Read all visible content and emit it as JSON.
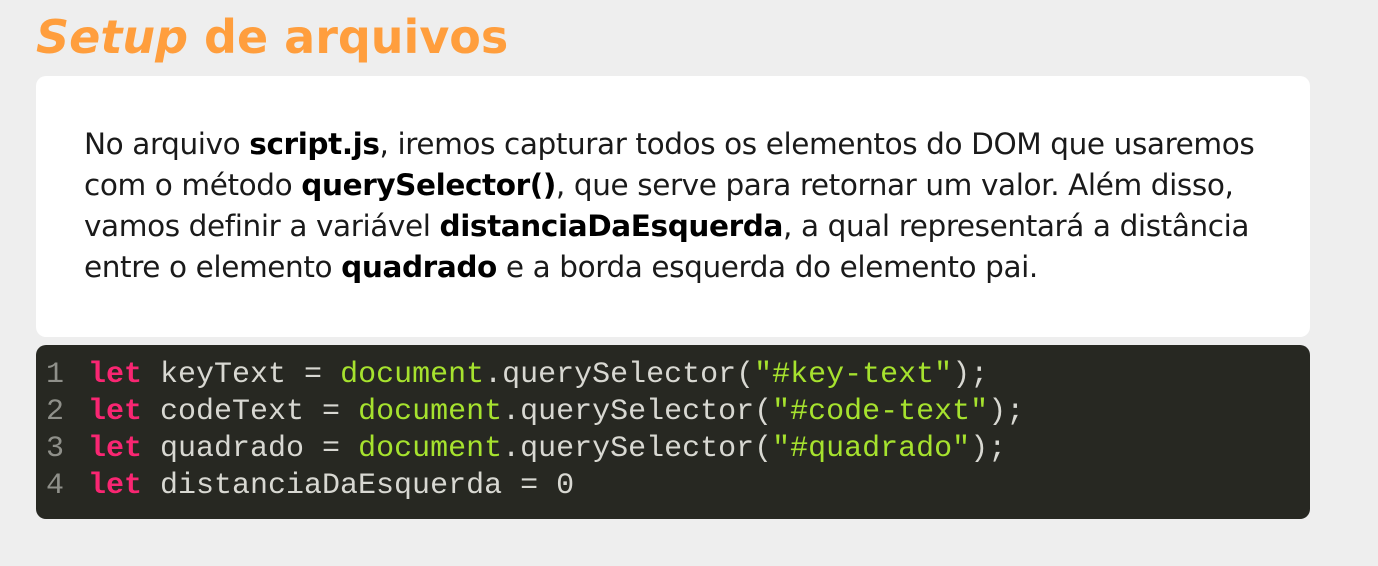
{
  "title": {
    "italic": "Setup",
    "rest": " de arquivos"
  },
  "paragraph": {
    "p1": "No arquivo ",
    "b1": "script.js",
    "p2": ", iremos capturar todos os elementos do DOM que usaremos com o método ",
    "b2": "querySelector()",
    "p3": ", que serve para retornar um valor. Além disso, vamos definir a variável ",
    "b3": "distanciaDaEsquerda",
    "p4": ", a qual representará a distância entre o elemento ",
    "b4": "quadrado",
    "p5": " e a borda esquerda do elemento pai."
  },
  "code": {
    "lines": [
      {
        "num": "1",
        "kw": "let",
        "name": " keyText = ",
        "obj": "document",
        "method": ".querySelector(",
        "str": "\"#key-text\"",
        "end": ");"
      },
      {
        "num": "2",
        "kw": "let",
        "name": " codeText = ",
        "obj": "document",
        "method": ".querySelector(",
        "str": "\"#code-text\"",
        "end": ");"
      },
      {
        "num": "3",
        "kw": "let",
        "name": " quadrado = ",
        "obj": "document",
        "method": ".querySelector(",
        "str": "\"#quadrado\"",
        "end": ");"
      },
      {
        "num": "4",
        "kw": "let",
        "name": " distanciaDaEsquerda = 0",
        "obj": "",
        "method": "",
        "str": "",
        "end": ""
      }
    ]
  },
  "colors": {
    "title": "#ff9e3d",
    "code_background": "#272822",
    "keyword": "#f92672",
    "document_and_string": "#a6e22e",
    "line_number": "#8f908a"
  }
}
